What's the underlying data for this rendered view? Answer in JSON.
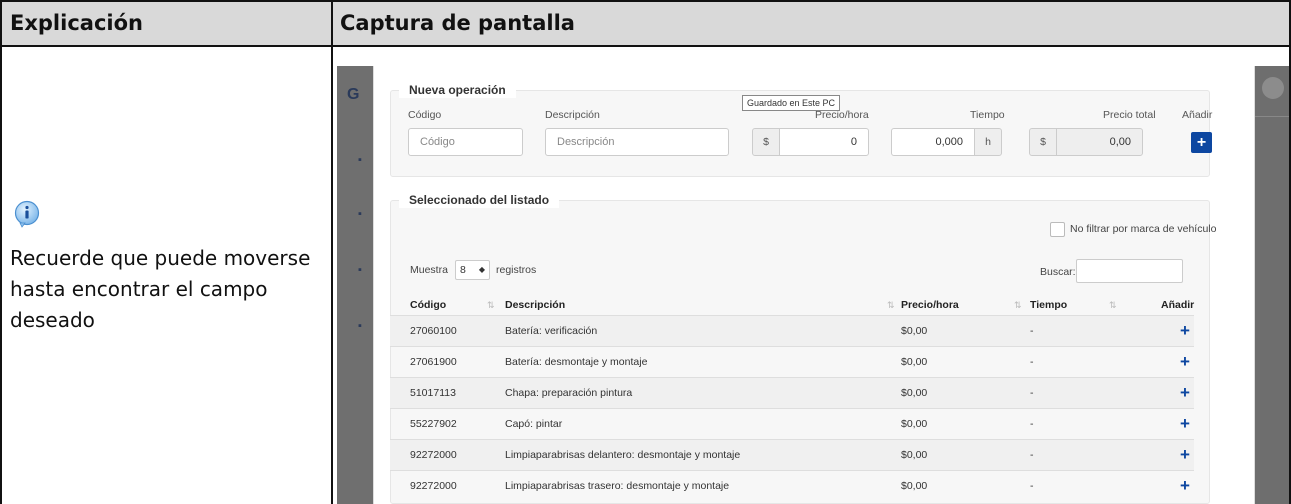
{
  "headers": {
    "left": "Explicación",
    "right": "Captura de pantalla"
  },
  "note": {
    "icon": "info-icon",
    "text": "Recuerde que puede moverse hasta encontrar el campo deseado"
  },
  "screenshot": {
    "accent_color": "#0d47a1",
    "nueva_operacion": {
      "legend": "Nueva operación",
      "tooltip": "Guardado en Este PC",
      "labels": {
        "codigo": "Código",
        "descripcion": "Descripción",
        "precio_hora": "Precio/hora",
        "tiempo": "Tiempo",
        "precio_total": "Precio total",
        "anadir": "Añadir"
      },
      "placeholders": {
        "codigo": "Código",
        "descripcion": "Descripción"
      },
      "values": {
        "precio_hora_addon": "$",
        "precio_hora": "0",
        "tiempo": "0,000",
        "tiempo_addon": "h",
        "precio_total_addon": "$",
        "precio_total": "0,00"
      },
      "add_label": "+"
    },
    "listado": {
      "legend": "Seleccionado del listado",
      "filter_label": "No filtrar por marca de vehículo",
      "muestra_label": "Muestra",
      "muestra_value": "8",
      "registros_label": "registros",
      "buscar_label": "Buscar:",
      "columns": [
        "Código",
        "Descripción",
        "Precio/hora",
        "Tiempo",
        "Añadir"
      ],
      "rows": [
        {
          "codigo": "27060100",
          "descripcion": "Batería: verificación",
          "precio": "$0,00",
          "tiempo": "-",
          "add": "+"
        },
        {
          "codigo": "27061900",
          "descripcion": "Batería: desmontaje y montaje",
          "precio": "$0,00",
          "tiempo": "-",
          "add": "+"
        },
        {
          "codigo": "51017113",
          "descripcion": "Chapa: preparación pintura",
          "precio": "$0,00",
          "tiempo": "-",
          "add": "+"
        },
        {
          "codigo": "55227902",
          "descripcion": "Capó: pintar",
          "precio": "$0,00",
          "tiempo": "-",
          "add": "+"
        },
        {
          "codigo": "92272000",
          "descripcion": "Limpiaparabrisas delantero: desmontaje y montaje",
          "precio": "$0,00",
          "tiempo": "-",
          "add": "+"
        },
        {
          "codigo": "92272000",
          "descripcion": "Limpiaparabrisas trasero: desmontaje y montaje",
          "precio": "$0,00",
          "tiempo": "-",
          "add": "+"
        }
      ]
    }
  }
}
